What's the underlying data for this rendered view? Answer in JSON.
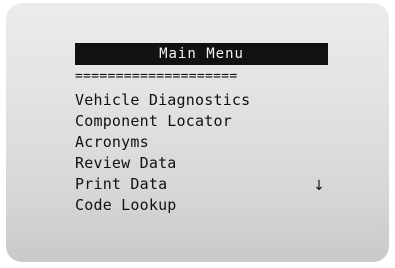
{
  "screen": {
    "title": "Main Menu",
    "separator": "===================="
  },
  "menu": {
    "items": [
      {
        "label": "Vehicle Diagnostics"
      },
      {
        "label": "Component Locator"
      },
      {
        "label": "Acronyms"
      },
      {
        "label": "Review Data"
      },
      {
        "label": "Print Data"
      },
      {
        "label": "Code Lookup"
      }
    ],
    "scroll_indicator": "↓"
  }
}
